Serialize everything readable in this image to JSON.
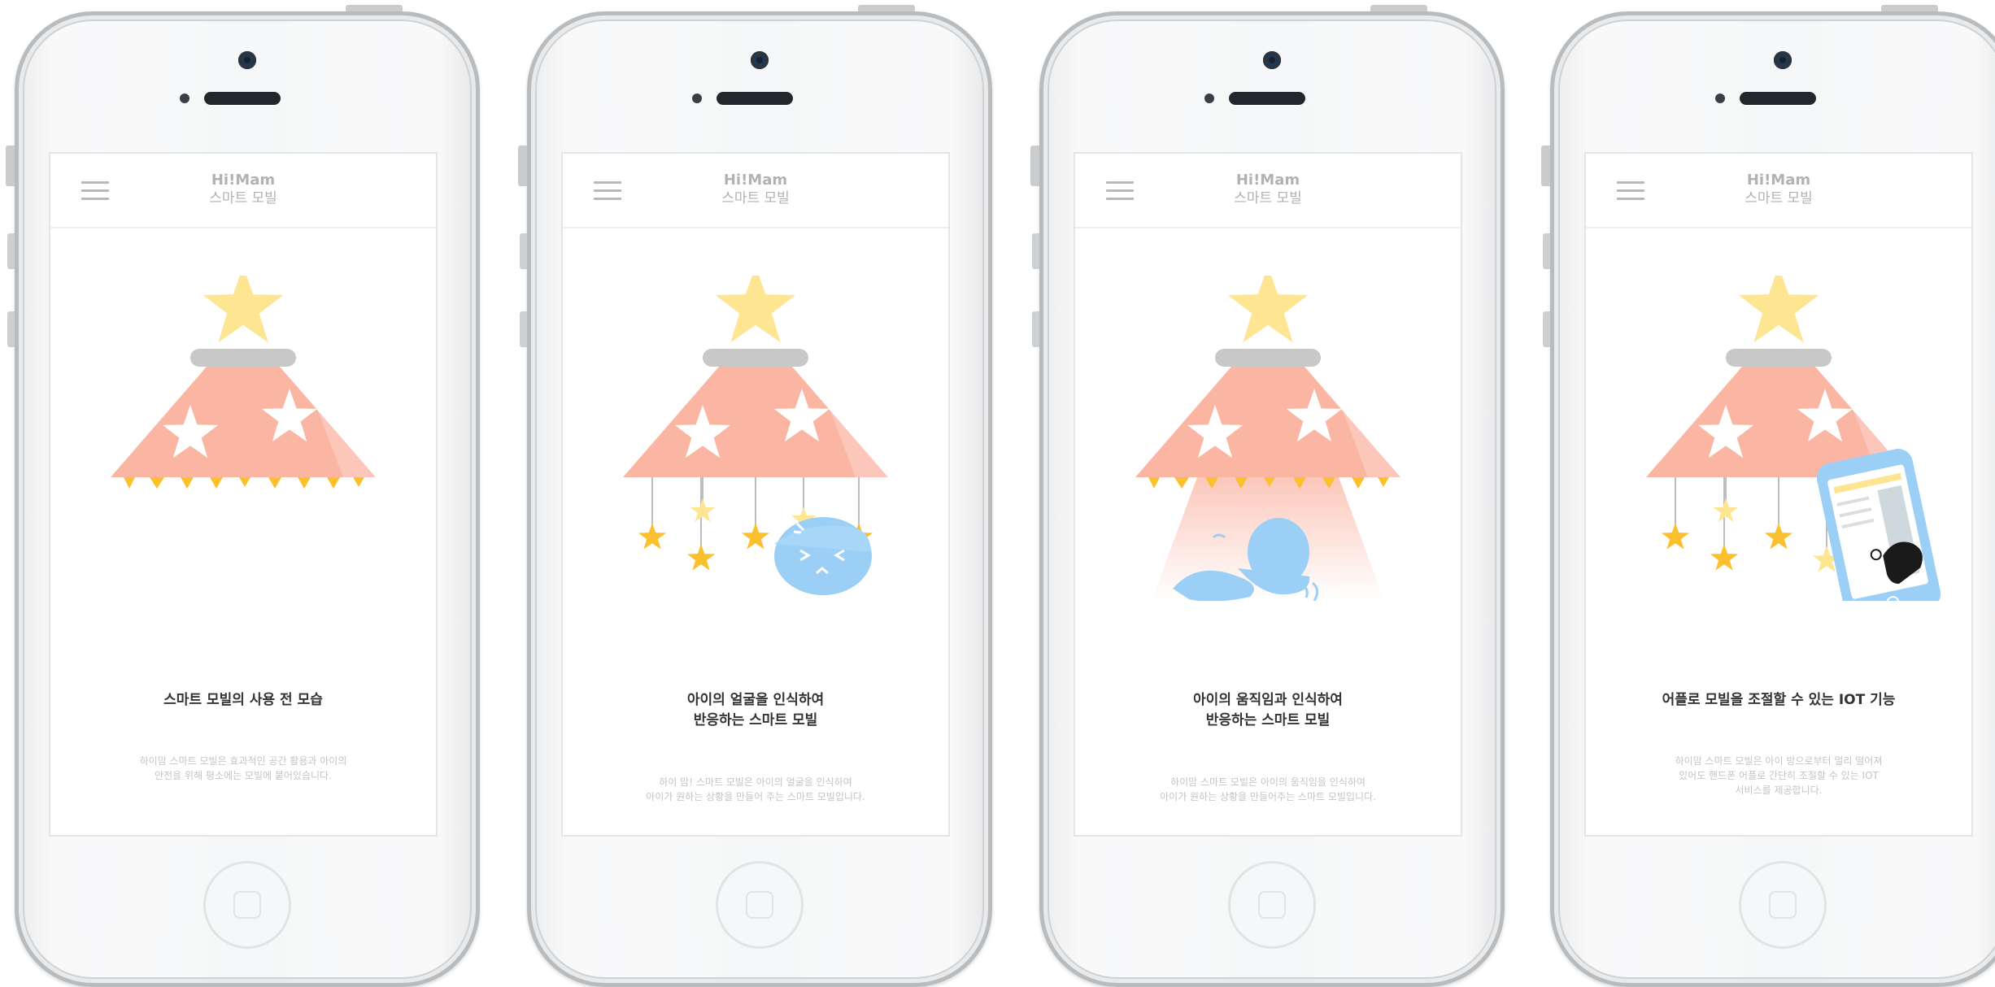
{
  "app": {
    "title": "Hi!Mam",
    "subtitle": "스마트 모빌"
  },
  "colors": {
    "canopy": "#fbb5a3",
    "star_yellow": "#fde592",
    "baby_blue": "#9ccff5",
    "hanging_star": "#fbc02d",
    "collar": "#c8c8c8"
  },
  "screens": [
    {
      "caption": "스마트 모빌의 사용 전 모습",
      "description": "하이맘 스마트 모빌은 효과적인 공간 활용과 아이의\n안전을 위해 평소에는 모빌에 붙어있습니다."
    },
    {
      "caption": "아이의 얼굴을 인식하여\n반응하는 스마트 모빌",
      "description": "하이 맘! 스마트 모빌은 아이의 얼굴을 인식하여\n아이가 원하는 상황을 만들어 주는 스마트 모빌입니다."
    },
    {
      "caption": "아이의 움직임과 인식하여\n반응하는 스마트 모빌",
      "description": "하이맘 스마트 모빌은 아이의 움직임을 인식하여\n아이가 원하는 상황을 만들어주는 스마트 모빌입니다."
    },
    {
      "caption": "어플로 모빌을 조절할 수 있는 IOT 기능",
      "description": "하이맘 스마트 모빌은 아이 방으로부터 멀리 떨어져\n있어도 핸드폰 어플로 간단히 조절할 수 있는 IOT\n서비스를 제공합니다."
    }
  ]
}
